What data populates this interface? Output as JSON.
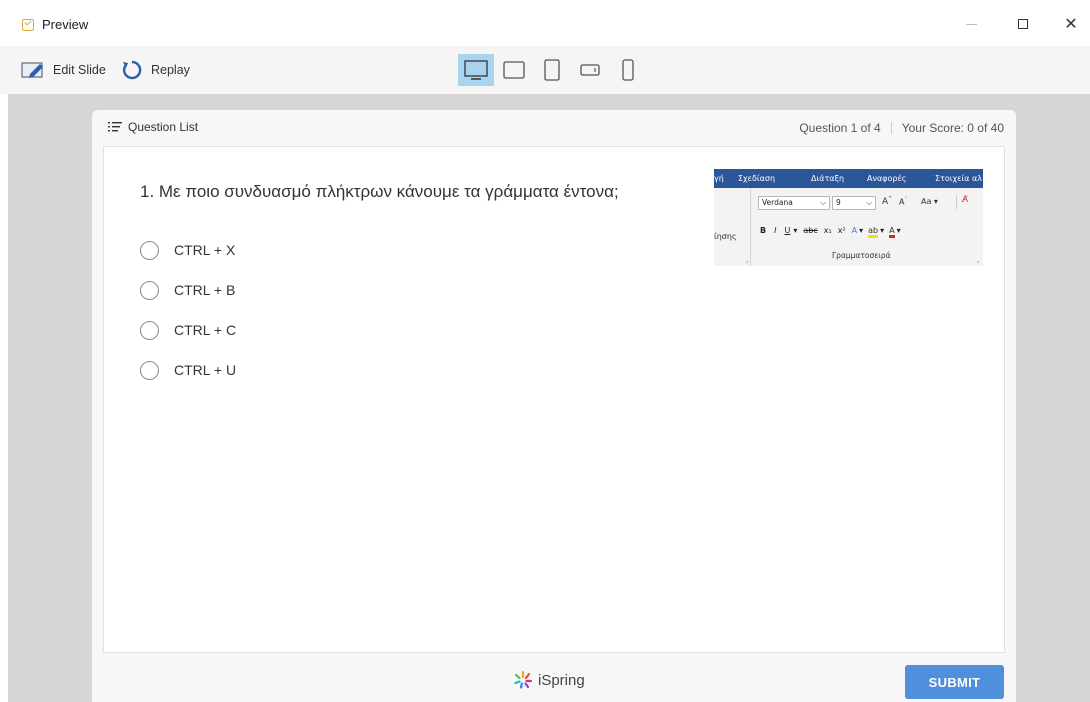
{
  "window": {
    "title": "Preview",
    "close_glyph": "✕"
  },
  "toolbar": {
    "edit_slide_label": "Edit Slide",
    "replay_label": "Replay",
    "devices": [
      "desktop",
      "tablet-landscape",
      "tablet-portrait",
      "phone-landscape",
      "phone-portrait"
    ],
    "active_device": "desktop"
  },
  "header": {
    "question_list_label": "Question List",
    "question_counter": "Question 1 of 4",
    "score_text": "Your Score: 0 of 40"
  },
  "question": {
    "text": "1. Με ποιο συνδυασμό πλήκτρων κάνουμε τα γράμματα έντονα;",
    "options": [
      "CTRL + X",
      "CTRL + B",
      "CTRL + C",
      "CTRL + U"
    ]
  },
  "ribbon_image": {
    "tabs": [
      "γή",
      "Σχεδίαση",
      "Διάταξη",
      "Αναφορές",
      "Στοιχεία αλ"
    ],
    "left_group_label": "ίησης",
    "font_name": "Verdana",
    "font_size": "9",
    "font_group_label": "Γραμματοσειρά",
    "aa_label": "Aa"
  },
  "footer": {
    "brand": "iSpring",
    "submit_label": "SUBMIT"
  },
  "colors": {
    "submit": "#4f8fdc",
    "active_device": "#a9d4f0",
    "ribbon_tab_bar": "#2b579a",
    "stage": "#d6d6d6"
  }
}
